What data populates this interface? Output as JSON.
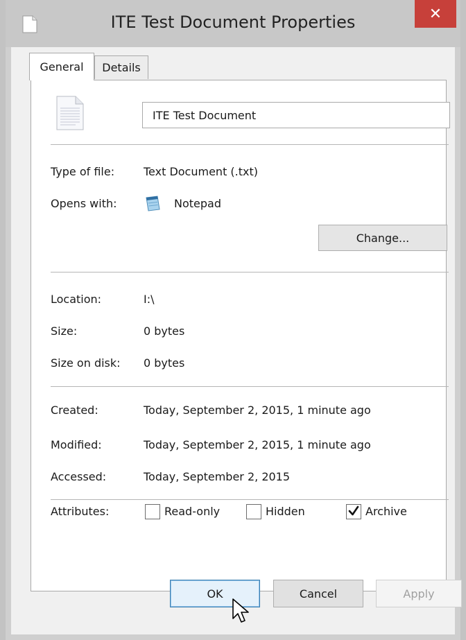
{
  "window": {
    "title": "ITE Test Document Properties",
    "close_glyph": "✕"
  },
  "tabs": [
    {
      "label": "General",
      "active": true
    },
    {
      "label": "Details",
      "active": false
    }
  ],
  "general": {
    "file_name": "ITE Test Document",
    "type_of_file": {
      "label": "Type of file:",
      "value": "Text Document (.txt)"
    },
    "opens_with": {
      "label": "Opens with:",
      "value": "Notepad",
      "change_label": "Change..."
    },
    "location": {
      "label": "Location:",
      "value": "I:\\"
    },
    "size": {
      "label": "Size:",
      "value": "0 bytes"
    },
    "size_on_disk": {
      "label": "Size on disk:",
      "value": "0 bytes"
    },
    "created": {
      "label": "Created:",
      "value": "Today, September 2, 2015, 1 minute ago"
    },
    "modified": {
      "label": "Modified:",
      "value": "Today, September 2, 2015, 1 minute ago"
    },
    "accessed": {
      "label": "Accessed:",
      "value": "Today, September 2, 2015"
    },
    "attributes": {
      "label": "Attributes:",
      "items": [
        {
          "label": "Read-only",
          "checked": false
        },
        {
          "label": "Hidden",
          "checked": false
        },
        {
          "label": "Archive",
          "checked": true
        }
      ]
    }
  },
  "buttons": {
    "ok": "OK",
    "cancel": "Cancel",
    "apply": "Apply"
  },
  "icons": {
    "title": "document-icon",
    "file": "text-file-icon",
    "opens_with": "notepad-icon",
    "cursor": "mouse-pointer-icon"
  },
  "colors": {
    "close_button": "#c7403a",
    "default_button_border": "#3c7fb1",
    "disabled_text": "#a0a0a0"
  }
}
